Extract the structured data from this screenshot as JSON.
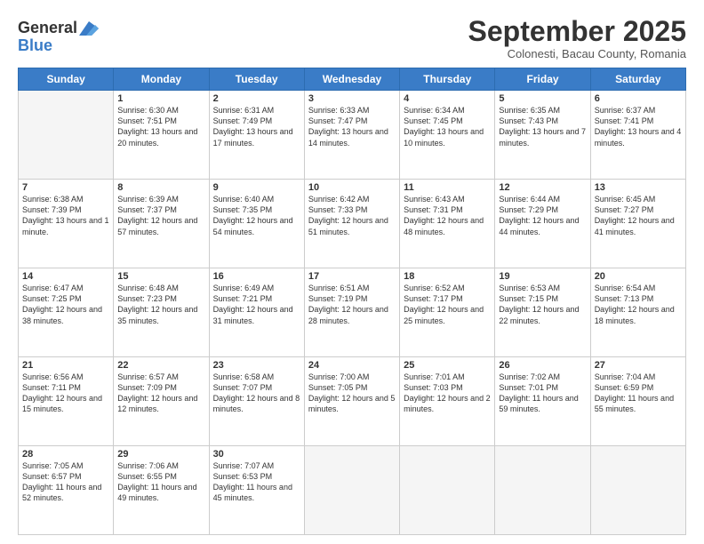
{
  "header": {
    "logo_general": "General",
    "logo_blue": "Blue",
    "month": "September 2025",
    "location": "Colonesti, Bacau County, Romania"
  },
  "weekdays": [
    "Sunday",
    "Monday",
    "Tuesday",
    "Wednesday",
    "Thursday",
    "Friday",
    "Saturday"
  ],
  "weeks": [
    [
      {
        "day": "",
        "sunrise": "",
        "sunset": "",
        "daylight": ""
      },
      {
        "day": "1",
        "sunrise": "Sunrise: 6:30 AM",
        "sunset": "Sunset: 7:51 PM",
        "daylight": "Daylight: 13 hours and 20 minutes."
      },
      {
        "day": "2",
        "sunrise": "Sunrise: 6:31 AM",
        "sunset": "Sunset: 7:49 PM",
        "daylight": "Daylight: 13 hours and 17 minutes."
      },
      {
        "day": "3",
        "sunrise": "Sunrise: 6:33 AM",
        "sunset": "Sunset: 7:47 PM",
        "daylight": "Daylight: 13 hours and 14 minutes."
      },
      {
        "day": "4",
        "sunrise": "Sunrise: 6:34 AM",
        "sunset": "Sunset: 7:45 PM",
        "daylight": "Daylight: 13 hours and 10 minutes."
      },
      {
        "day": "5",
        "sunrise": "Sunrise: 6:35 AM",
        "sunset": "Sunset: 7:43 PM",
        "daylight": "Daylight: 13 hours and 7 minutes."
      },
      {
        "day": "6",
        "sunrise": "Sunrise: 6:37 AM",
        "sunset": "Sunset: 7:41 PM",
        "daylight": "Daylight: 13 hours and 4 minutes."
      }
    ],
    [
      {
        "day": "7",
        "sunrise": "Sunrise: 6:38 AM",
        "sunset": "Sunset: 7:39 PM",
        "daylight": "Daylight: 13 hours and 1 minute."
      },
      {
        "day": "8",
        "sunrise": "Sunrise: 6:39 AM",
        "sunset": "Sunset: 7:37 PM",
        "daylight": "Daylight: 12 hours and 57 minutes."
      },
      {
        "day": "9",
        "sunrise": "Sunrise: 6:40 AM",
        "sunset": "Sunset: 7:35 PM",
        "daylight": "Daylight: 12 hours and 54 minutes."
      },
      {
        "day": "10",
        "sunrise": "Sunrise: 6:42 AM",
        "sunset": "Sunset: 7:33 PM",
        "daylight": "Daylight: 12 hours and 51 minutes."
      },
      {
        "day": "11",
        "sunrise": "Sunrise: 6:43 AM",
        "sunset": "Sunset: 7:31 PM",
        "daylight": "Daylight: 12 hours and 48 minutes."
      },
      {
        "day": "12",
        "sunrise": "Sunrise: 6:44 AM",
        "sunset": "Sunset: 7:29 PM",
        "daylight": "Daylight: 12 hours and 44 minutes."
      },
      {
        "day": "13",
        "sunrise": "Sunrise: 6:45 AM",
        "sunset": "Sunset: 7:27 PM",
        "daylight": "Daylight: 12 hours and 41 minutes."
      }
    ],
    [
      {
        "day": "14",
        "sunrise": "Sunrise: 6:47 AM",
        "sunset": "Sunset: 7:25 PM",
        "daylight": "Daylight: 12 hours and 38 minutes."
      },
      {
        "day": "15",
        "sunrise": "Sunrise: 6:48 AM",
        "sunset": "Sunset: 7:23 PM",
        "daylight": "Daylight: 12 hours and 35 minutes."
      },
      {
        "day": "16",
        "sunrise": "Sunrise: 6:49 AM",
        "sunset": "Sunset: 7:21 PM",
        "daylight": "Daylight: 12 hours and 31 minutes."
      },
      {
        "day": "17",
        "sunrise": "Sunrise: 6:51 AM",
        "sunset": "Sunset: 7:19 PM",
        "daylight": "Daylight: 12 hours and 28 minutes."
      },
      {
        "day": "18",
        "sunrise": "Sunrise: 6:52 AM",
        "sunset": "Sunset: 7:17 PM",
        "daylight": "Daylight: 12 hours and 25 minutes."
      },
      {
        "day": "19",
        "sunrise": "Sunrise: 6:53 AM",
        "sunset": "Sunset: 7:15 PM",
        "daylight": "Daylight: 12 hours and 22 minutes."
      },
      {
        "day": "20",
        "sunrise": "Sunrise: 6:54 AM",
        "sunset": "Sunset: 7:13 PM",
        "daylight": "Daylight: 12 hours and 18 minutes."
      }
    ],
    [
      {
        "day": "21",
        "sunrise": "Sunrise: 6:56 AM",
        "sunset": "Sunset: 7:11 PM",
        "daylight": "Daylight: 12 hours and 15 minutes."
      },
      {
        "day": "22",
        "sunrise": "Sunrise: 6:57 AM",
        "sunset": "Sunset: 7:09 PM",
        "daylight": "Daylight: 12 hours and 12 minutes."
      },
      {
        "day": "23",
        "sunrise": "Sunrise: 6:58 AM",
        "sunset": "Sunset: 7:07 PM",
        "daylight": "Daylight: 12 hours and 8 minutes."
      },
      {
        "day": "24",
        "sunrise": "Sunrise: 7:00 AM",
        "sunset": "Sunset: 7:05 PM",
        "daylight": "Daylight: 12 hours and 5 minutes."
      },
      {
        "day": "25",
        "sunrise": "Sunrise: 7:01 AM",
        "sunset": "Sunset: 7:03 PM",
        "daylight": "Daylight: 12 hours and 2 minutes."
      },
      {
        "day": "26",
        "sunrise": "Sunrise: 7:02 AM",
        "sunset": "Sunset: 7:01 PM",
        "daylight": "Daylight: 11 hours and 59 minutes."
      },
      {
        "day": "27",
        "sunrise": "Sunrise: 7:04 AM",
        "sunset": "Sunset: 6:59 PM",
        "daylight": "Daylight: 11 hours and 55 minutes."
      }
    ],
    [
      {
        "day": "28",
        "sunrise": "Sunrise: 7:05 AM",
        "sunset": "Sunset: 6:57 PM",
        "daylight": "Daylight: 11 hours and 52 minutes."
      },
      {
        "day": "29",
        "sunrise": "Sunrise: 7:06 AM",
        "sunset": "Sunset: 6:55 PM",
        "daylight": "Daylight: 11 hours and 49 minutes."
      },
      {
        "day": "30",
        "sunrise": "Sunrise: 7:07 AM",
        "sunset": "Sunset: 6:53 PM",
        "daylight": "Daylight: 11 hours and 45 minutes."
      },
      {
        "day": "",
        "sunrise": "",
        "sunset": "",
        "daylight": ""
      },
      {
        "day": "",
        "sunrise": "",
        "sunset": "",
        "daylight": ""
      },
      {
        "day": "",
        "sunrise": "",
        "sunset": "",
        "daylight": ""
      },
      {
        "day": "",
        "sunrise": "",
        "sunset": "",
        "daylight": ""
      }
    ]
  ]
}
